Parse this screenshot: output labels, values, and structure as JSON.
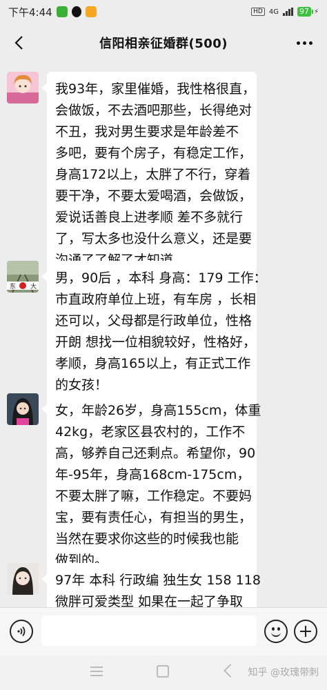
{
  "status_bar": {
    "time": "下午4:44",
    "icons": [
      "wechat-icon",
      "qq-icon",
      "files-icon"
    ],
    "hd": "HD",
    "network": "4G",
    "battery": "97"
  },
  "header": {
    "title": "信阳相亲征婚群(500)",
    "back_icon": "chevron-left-icon",
    "more_icon": "more-dots-icon"
  },
  "messages": [
    {
      "lines": [
        "我93年，家里催婚，我性格很直，",
        "会做饭，不去酒吧那些，长得绝对",
        "不丑，我对男生要求是年龄差不",
        "多吧，要有个房子，有稳定工作，",
        "身高172以上，太胖了不行，穿着",
        "要干净，不要太爱喝酒，会做饭，",
        "爱说话善良上进孝顺 差不多就行",
        "了，写太多也没什么意义，还是要",
        "沟通了了解了才知道"
      ]
    },
    {
      "avatar_text": [
        "东",
        "大"
      ],
      "lines": [
        "男，90后 ，本科 身高：179 工作：",
        "市直政府单位上班，有车房 ，长相",
        "还可以，父母都是行政单位，性格",
        "开朗 想找一位相貌较好，性格好，",
        "孝顺，身高165以上，有正式工作",
        "的女孩！"
      ]
    },
    {
      "lines": [
        "女，年龄26岁，身高155cm，体重",
        "42kg，老家区县农村的，工作不",
        "高，够养自己还剩点。希望你，90",
        "年-95年，身高168cm-175cm，",
        "不要太胖了嘛，工作稳定。不要妈",
        "宝，要有责任心，有担当的男生，",
        "当然在要求你这些的时候我也能",
        "做到的。"
      ]
    },
    {
      "lines": [
        "97年 本科 行政编 独生女 158 118",
        "微胖可爱类型  如果在一起了争取"
      ]
    }
  ],
  "input_bar": {
    "voice_icon": "voice-icon",
    "placeholder": "",
    "emoji_icon": "emoji-icon",
    "plus_icon": "plus-icon"
  },
  "watermark": "知乎 @玫瑰带刺",
  "colors": {
    "background": "#ededed",
    "bubble": "#ffffff",
    "battery": "#3fc13f"
  }
}
